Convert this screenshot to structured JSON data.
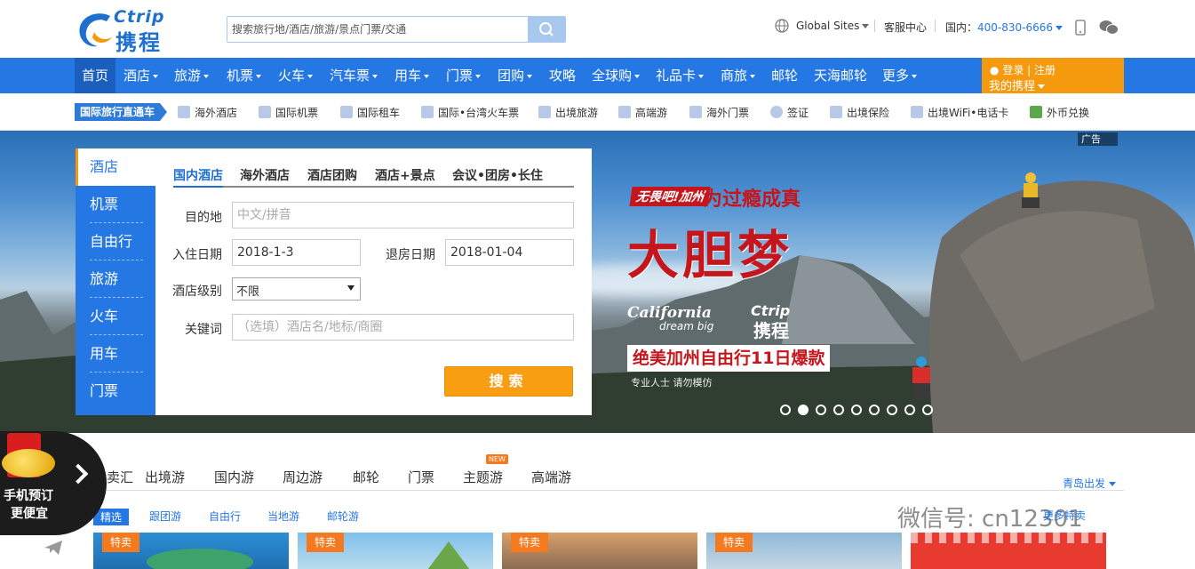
{
  "header": {
    "logo_en": "Ctrip",
    "logo_cn": "携程",
    "search_placeholder": "搜索旅行地/酒店/旅游/景点门票/交通",
    "global_sites": "Global Sites",
    "customer_service": "客服中心",
    "domestic_label": "国内：",
    "phone": "400-830-6666"
  },
  "nav": {
    "items": [
      "首页",
      "酒店",
      "旅游",
      "机票",
      "火车",
      "汽车票",
      "用车",
      "门票",
      "团购",
      "攻略",
      "全球购",
      "礼品卡",
      "商旅",
      "邮轮",
      "天海邮轮",
      "更多"
    ],
    "login": "登录",
    "register": "注册",
    "my_ctrip": "我的携程"
  },
  "subnav": {
    "tag": "国际旅行直通车",
    "items": [
      "海外酒店",
      "国际机票",
      "国际租车",
      "国际•台湾火车票",
      "出境旅游",
      "高端游",
      "海外门票",
      "签证",
      "出境保险",
      "出境WiFi•电话卡",
      "外币兑换"
    ]
  },
  "banner": {
    "ad_label": "广告",
    "slogan_tag": "无畏吧!加州",
    "slogan_tail": "为过瘾成真",
    "headline": "大胆梦",
    "california": "California",
    "dream_big": "dream big",
    "ctrip_en": "Ctrip",
    "ctrip_cn": "携程",
    "strip": "绝美加州自由行11日爆款",
    "note": "专业人士  请勿模仿",
    "slide_count": 9,
    "active_slide": 2
  },
  "booking": {
    "side": [
      "酒店",
      "机票",
      "自由行",
      "旅游",
      "火车",
      "用车",
      "门票"
    ],
    "tabs": [
      "国内酒店",
      "海外酒店",
      "酒店团购",
      "酒店+景点",
      "会议•团房•长住"
    ],
    "destination_label": "目的地",
    "destination_placeholder": "中文/拼音",
    "checkin_label": "入住日期",
    "checkin_value": "2018-1-3",
    "checkout_label": "退房日期",
    "checkout_value": "2018-01-04",
    "level_label": "酒店级别",
    "level_value": "不限",
    "keyword_label": "关键词",
    "keyword_placeholder": "（选填）酒店名/地标/商圈",
    "search_button": "搜索"
  },
  "section": {
    "tabs": [
      "特卖汇",
      "出境游",
      "国内游",
      "周边游",
      "邮轮",
      "门票",
      "主题游",
      "高端游"
    ],
    "new_badge": "NEW",
    "depart": "青岛出发",
    "filters": [
      "精选",
      "跟团游",
      "自由行",
      "当地游",
      "邮轮游"
    ],
    "card_badge": "特卖",
    "more_link": "更多特卖"
  },
  "float_ad": {
    "line1": "手机预订",
    "line2": "更便宜"
  },
  "watermark": "微信号: cn12301",
  "colors": {
    "brand_blue": "#2577e3",
    "accent_orange": "#f59a0e",
    "promo_red": "#c4161c"
  }
}
